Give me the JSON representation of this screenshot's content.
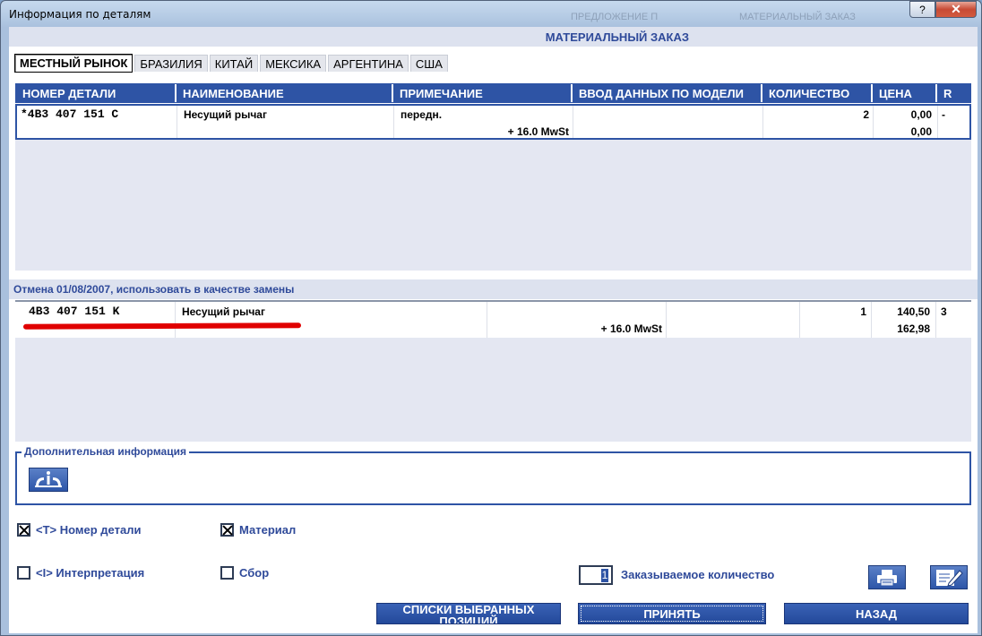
{
  "window": {
    "title": "Информация по деталям",
    "help_label": "?",
    "close_label": "✕",
    "ghost_text_1": "ПРЕДЛОЖЕНИЕ П",
    "ghost_text_2": "МАТЕРИАЛЬНЫЙ ЗАКАЗ"
  },
  "header": {
    "title": "МАТЕРИАЛЬНЫЙ ЗАКАЗ"
  },
  "tabs": [
    {
      "label": "МЕСТНЫЙ РЫНОК",
      "active": true
    },
    {
      "label": "БРАЗИЛИЯ"
    },
    {
      "label": "КИТАЙ"
    },
    {
      "label": "МЕКСИКА"
    },
    {
      "label": "АРГЕНТИНА"
    },
    {
      "label": "США"
    }
  ],
  "columns": [
    "НОМЕР ДЕТАЛИ",
    "НАИМЕНОВАНИЕ",
    "ПРИМЕЧАНИЕ",
    "ВВОД ДАННЫХ ПО МОДЕЛИ",
    "КОЛИЧЕСТВО",
    "ЦЕНА",
    "R"
  ],
  "main_row": {
    "part_number": "*4B3 407 151 C",
    "name": "Несущий рычаг",
    "note": "передн.",
    "tax": "+ 16.0 MwSt",
    "model_input": "",
    "quantity": "2",
    "price": "0,00",
    "price_total": "0,00",
    "r": "-"
  },
  "replacement": {
    "title": "Отмена 01/08/2007, использовать в качестве замены",
    "part_number": "4B3 407 151 K",
    "name": "Несущий рычаг",
    "note": "",
    "tax": "+ 16.0 MwSt",
    "model_input": "",
    "quantity": "1",
    "price": "140,50",
    "price_total": "162,98",
    "r": "3"
  },
  "additional_info": {
    "legend": "Дополнительная информация",
    "icon": "info-icon"
  },
  "checkboxes": {
    "part_number": {
      "label": "<T> Номер детали",
      "checked": true
    },
    "material": {
      "label": "Материал",
      "checked": true
    },
    "interpretation": {
      "label": "<I> Интерпретация",
      "checked": false
    },
    "assembly": {
      "label": "Сбор",
      "checked": false
    }
  },
  "order_quantity": {
    "value": "1",
    "label": "Заказываемое количество"
  },
  "buttons": {
    "selected_lists": "СПИСКИ ВЫБРАННЫХ ПОЗИЦИЙ",
    "accept": "ПРИНЯТЬ",
    "back": "НАЗАД"
  },
  "icons": {
    "print": "printer-icon",
    "edit": "edit-note-icon"
  },
  "colors": {
    "header_blue": "#2e54a5",
    "accent_text": "#2f4a9a",
    "highlight_red": "#e00000"
  }
}
